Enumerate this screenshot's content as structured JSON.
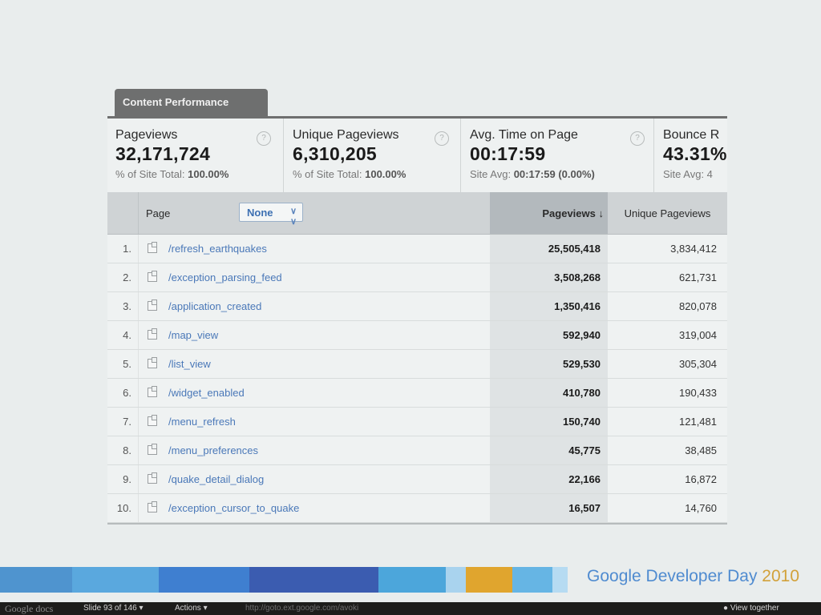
{
  "tab_title": "Content Performance",
  "metrics": [
    {
      "name": "Pageviews",
      "value": "32,171,724",
      "sub_label": "% of Site Total:",
      "sub_value": "100.00%"
    },
    {
      "name": "Unique Pageviews",
      "value": "6,310,205",
      "sub_label": "% of Site Total:",
      "sub_value": "100.00%"
    },
    {
      "name": "Avg. Time on Page",
      "value": "00:17:59",
      "sub_label": "Site Avg:",
      "sub_value": "00:17:59 (0.00%)"
    },
    {
      "name": "Bounce R",
      "value": "43.31%",
      "sub_label": "Site Avg: 4",
      "sub_value": ""
    }
  ],
  "help_glyph": "?",
  "table": {
    "page_label": "Page",
    "secondary_dimension": "None",
    "col_pageviews": "Pageviews",
    "sort_arrow": "↓",
    "col_unique": "Unique Pageviews",
    "rows": [
      {
        "num": "1.",
        "page": "/refresh_earthquakes",
        "pageviews": "25,505,418",
        "unique": "3,834,412"
      },
      {
        "num": "2.",
        "page": "/exception_parsing_feed",
        "pageviews": "3,508,268",
        "unique": "621,731"
      },
      {
        "num": "3.",
        "page": "/application_created",
        "pageviews": "1,350,416",
        "unique": "820,078"
      },
      {
        "num": "4.",
        "page": "/map_view",
        "pageviews": "592,940",
        "unique": "319,004"
      },
      {
        "num": "5.",
        "page": "/list_view",
        "pageviews": "529,530",
        "unique": "305,304"
      },
      {
        "num": "6.",
        "page": "/widget_enabled",
        "pageviews": "410,780",
        "unique": "190,433"
      },
      {
        "num": "7.",
        "page": "/menu_refresh",
        "pageviews": "150,740",
        "unique": "121,481"
      },
      {
        "num": "8.",
        "page": "/menu_preferences",
        "pageviews": "45,775",
        "unique": "38,485"
      },
      {
        "num": "9.",
        "page": "/quake_detail_dialog",
        "pageviews": "22,166",
        "unique": "16,872"
      },
      {
        "num": "10.",
        "page": "/exception_cursor_to_quake",
        "pageviews": "16,507",
        "unique": "14,760"
      }
    ]
  },
  "brand": {
    "name": "Google Developer Day",
    "year": "2010"
  },
  "colors": {
    "brand_blue": "#4f8bd0",
    "brand_gold": "#d2a13a",
    "link": "#4a78b8"
  },
  "statusbar": {
    "logo": "Google docs",
    "slide": "Slide 93 of 146 ▾",
    "actions": "Actions ▾",
    "url": "http://goto.ext.google.com/avoki",
    "view_together": "View together"
  }
}
